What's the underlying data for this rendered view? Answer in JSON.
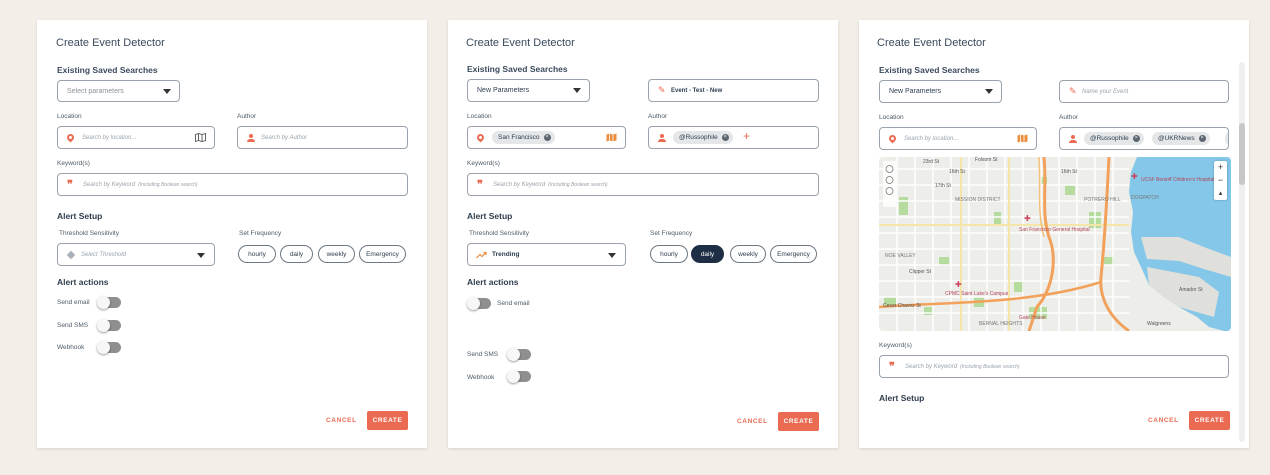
{
  "brand_color": "#ea6a52",
  "panels": [
    {
      "title": "Create Event Detector",
      "saved_searches_label": "Existing Saved Searches",
      "saved_search_value": "Select parameters",
      "location_label": "Location",
      "location_placeholder": "Search by location...",
      "author_label": "Author",
      "author_placeholder": "Search by Author",
      "keyword_label": "Keyword(s)",
      "keyword_placeholder": "Search by Keyword",
      "keyword_hint": "(Including Boolean search)",
      "alert_setup": "Alert Setup",
      "threshold_label": "Threshold Sensitivity",
      "threshold_value": "Select Threshold",
      "frequency_label": "Set Frequency",
      "frequency_options": [
        "hourly",
        "daily",
        "weekly",
        "Emergency"
      ],
      "alert_actions": "Alert actions",
      "actions": [
        "Send email",
        "Send SMS",
        "Webhook"
      ],
      "cancel": "CANCEL",
      "create": "CREATE"
    },
    {
      "title": "Create Event Detector",
      "saved_searches_label": "Existing Saved Searches",
      "saved_search_value": "New Parameters",
      "event_name": "Event - Test - New",
      "location_label": "Location",
      "location_chip": "San Francisco",
      "author_label": "Author",
      "author_chip": "@Russophile",
      "keyword_label": "Keyword(s)",
      "keyword_placeholder": "Search by Keyword",
      "keyword_hint": "(Including Boolean search)",
      "alert_setup": "Alert Setup",
      "threshold_label": "Threshold Sensitivity",
      "threshold_value": "Trending",
      "frequency_label": "Set Frequency",
      "frequency_options": [
        "hourly",
        "daily",
        "weekly",
        "Emergency"
      ],
      "frequency_selected": "daily",
      "alert_actions": "Alert actions",
      "actions": [
        "Send email",
        "Send SMS",
        "Webhook"
      ],
      "cancel": "CANCEL",
      "create": "CREATE"
    },
    {
      "title": "Create Event Detector",
      "saved_searches_label": "Existing Saved Searches",
      "saved_search_value": "New Parameters",
      "event_name_placeholder": "Name your Event",
      "location_label": "Location",
      "location_placeholder": "Search by location...",
      "author_label": "Author",
      "author_chips": [
        "@Russophile",
        "@UKRNews"
      ],
      "keyword_label": "Keyword(s)",
      "keyword_placeholder": "Search by Keyword",
      "keyword_hint": "(Including Boolean search)",
      "alert_setup": "Alert Setup",
      "cancel": "CANCEL",
      "create": "CREATE",
      "map_labels": {
        "l1": "23rd St",
        "l2": "Folsom St",
        "l3": "16th St",
        "l4": "16th St",
        "l5": "17th St",
        "l6": "UCSF Benioff Children's Hospital",
        "l7": "MISSION DISTRICT",
        "l8": "POTRERO HILL",
        "l9": "DOGPATCH",
        "l10": "San Francisco General Hospital",
        "l11": "NOE VALLEY",
        "l12": "Clipper St",
        "l13": "CPMC Saint Luke's Campus",
        "l14": "BERNAL HEIGHTS",
        "l15": "Walgreens",
        "l16": "Gate House",
        "l17": "Amador St",
        "l18": "Cesar Chavez St"
      }
    }
  ],
  "icons": [
    "location-pin-icon",
    "map-icon",
    "person-icon",
    "quote-icon",
    "pencil-icon",
    "caret-down-icon",
    "chip-remove-icon",
    "plus-icon",
    "trending-icon",
    "threshold-icon",
    "zoom-in-icon",
    "zoom-out-icon"
  ]
}
